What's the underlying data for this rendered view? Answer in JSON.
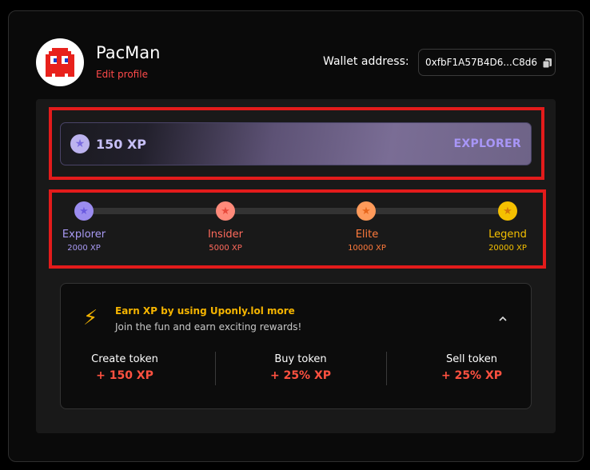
{
  "profile": {
    "username": "PacMan",
    "edit_label": "Edit profile",
    "avatar_icon": "red-ghost-avatar"
  },
  "wallet": {
    "label": "Wallet address:",
    "address": "0xfbF1A57B4D6...C8d6",
    "copy_icon": "copy-icon"
  },
  "xp": {
    "value": "150 XP",
    "rank": "EXPLORER",
    "icon": "star-coin-icon"
  },
  "levels": [
    {
      "name": "Explorer",
      "xp": "2000 XP",
      "color": "#a99af5",
      "dot_color": "#9b8cf0"
    },
    {
      "name": "Insider",
      "xp": "5000 XP",
      "color": "#ff6a5c",
      "dot_color": "#ff8a7a"
    },
    {
      "name": "Elite",
      "xp": "10000 XP",
      "color": "#ff7a3c",
      "dot_color": "#ff9a5a"
    },
    {
      "name": "Legend",
      "xp": "20000 XP",
      "color": "#f5c000",
      "dot_color": "#f5c000"
    }
  ],
  "earn": {
    "title": "Earn XP by using Uponly.lol more",
    "subtitle": "Join the fun and earn exciting rewards!",
    "actions": [
      {
        "label": "Create token",
        "value": "+ 150 XP"
      },
      {
        "label": "Buy token",
        "value": "+ 25% XP"
      },
      {
        "label": "Sell token",
        "value": "+ 25% XP"
      }
    ]
  },
  "colors": {
    "accent_red": "#ff4a4a",
    "highlight_border": "#e31b1b",
    "gold": "#f5b400",
    "purple": "#a896f7"
  }
}
